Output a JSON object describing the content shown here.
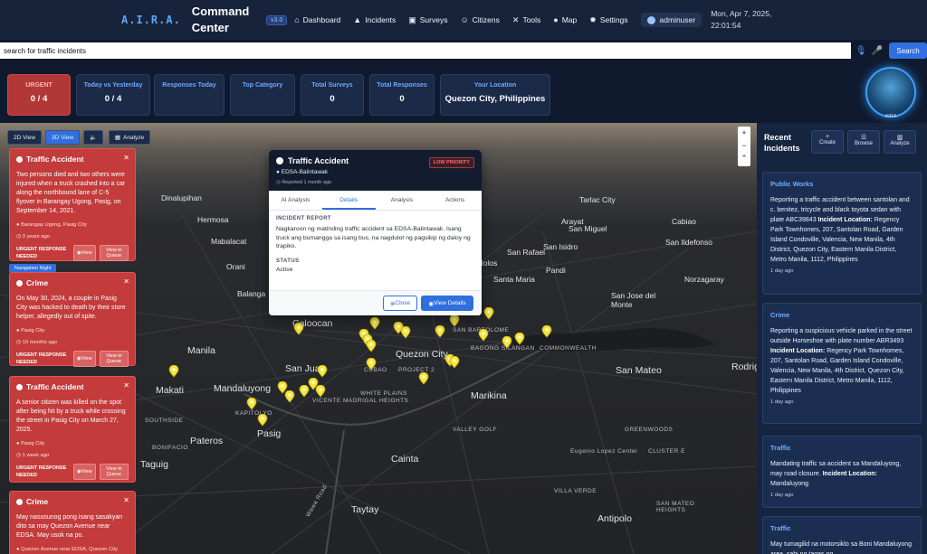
{
  "app": {
    "brand_aira": "A.I.R.A.",
    "brand_line1": "Command",
    "brand_line2": "Center",
    "version": "v3.0",
    "datetime_line1": "Mon, Apr 7, 2025,",
    "datetime_line2": "22:01:54",
    "user": "adminuser"
  },
  "nav": [
    {
      "label": "Dashboard",
      "icon": "home-icon"
    },
    {
      "label": "Incidents",
      "icon": "warning-icon"
    },
    {
      "label": "Surveys",
      "icon": "clipboard-icon"
    },
    {
      "label": "Citizens",
      "icon": "users-icon"
    },
    {
      "label": "Tools",
      "icon": "tools-icon"
    },
    {
      "label": "Map",
      "icon": "map-pin-icon"
    },
    {
      "label": "Settings",
      "icon": "gear-icon"
    }
  ],
  "search": {
    "value": "search for traffic incidents",
    "button": "Search"
  },
  "stats": [
    {
      "label": "URGENT",
      "value": "0 / 4"
    },
    {
      "label": "Today vs Yesterday",
      "value": "0 / 4"
    },
    {
      "label": "Responses Today",
      "value": ""
    },
    {
      "label": "Top Category",
      "value": ""
    },
    {
      "label": "Total Surveys",
      "value": "0"
    },
    {
      "label": "Total Responses",
      "value": "0"
    },
    {
      "label": "Your Location",
      "value": "Quezon City, Philippines"
    }
  ],
  "avatar_label": "AIRA",
  "map_controls": {
    "view2d": "2D View",
    "view3d": "3D View",
    "analyze": "Analyze",
    "zoom_in": "+",
    "zoom_out": "−"
  },
  "map_places": {
    "big": [
      "Manila",
      "Quezon City",
      "Makati",
      "Mandaluyong",
      "Pasig",
      "Marikina",
      "Taguig",
      "Cainta",
      "Taytay",
      "Antipolo",
      "Caloocan",
      "San Juan",
      "San Mateo",
      "Pateros",
      "Rodrig"
    ],
    "med": [
      "Tarlac City",
      "San Rafael",
      "Cabiao",
      "San Isidro",
      "Malolos",
      "Santa Maria",
      "San Jose del Monte",
      "Norzagaray",
      "Pandi",
      "Arayat",
      "Dinalupihan",
      "San Ildefonso",
      "San Miguel",
      "Mabalacat",
      "Hermosa",
      "Orani",
      "Balanga"
    ],
    "sm": [
      "PROJECT 2",
      "WHITE PLAINS",
      "CUBAO",
      "COMMONWEALTH",
      "SOUTHSIDE",
      "BAGONG SILANGAN",
      "SAN BARTOLOME",
      "VALLEY GOLF",
      "CLUSTER E",
      "GREENWOODS",
      "Eugenio Lopez Center",
      "VILLA VERDE",
      "BONIFACIO",
      "KAPITOLYO",
      "VICENTE MADRIGAL HEIGHTS",
      "SAN MATEO HEIGHTS",
      "Wawa Road"
    ]
  },
  "incident_cards": [
    {
      "title": "Traffic Accident",
      "desc": "Two persons died and two others were injured when a truck crashed into a car along the northbound lane of C-5 flyover in Barangay Ugong, Pasig, on September 14, 2021.",
      "location": "Barangay Ugong, Pasig City",
      "ago": "3 years ago",
      "urgent": "URGENT RESPONSE NEEDED",
      "view": "View",
      "queue": "View in Queue"
    },
    {
      "title": "Crime",
      "desc": "On May 30, 2024, a couple in Pasig City was hacked to death by their store helper, allegedly out of spite.",
      "location": "Pasig City",
      "ago": "10 months ago",
      "urgent": "URGENT RESPONSE NEEDED",
      "view": "View",
      "queue": "View in Queue"
    },
    {
      "title": "Traffic Accident",
      "desc": "A senior citizen was killed on the spot after being hit by a truck while crossing the street in Pasig City on March 27, 2025.",
      "location": "Pasig City",
      "ago": "1 week ago",
      "urgent": "URGENT RESPONSE NEEDED",
      "view": "View",
      "queue": "View in Queue"
    },
    {
      "title": "Crime",
      "desc": "May nasusunog pong isang sasakyan dito sa may Quezon Avenue near EDSA. May usok na po.",
      "location": "Quezon Avenue near EDSA, Quezon City",
      "ago": "",
      "urgent": "",
      "view": "",
      "queue": ""
    }
  ],
  "nav_night": "Navigation Night",
  "popup": {
    "title": "Traffic Accident",
    "location": "EDSA-Balintawak",
    "reported": "Reported 1 month ago",
    "priority": "LOW PRIORITY",
    "tabs": [
      "AI Analysis",
      "Details",
      "Analysis",
      "Actions"
    ],
    "report_heading": "INCIDENT REPORT",
    "report_text": "Nagkaroon ng matinding traffic accident sa EDSA-Balintawak. Isang truck ang bumangga sa isang bus, na nagdulot ng pagsikip ng daloy ng trapiko.",
    "status_heading": "STATUS",
    "status_value": "Active",
    "close": "Close",
    "view_details": "View Details"
  },
  "right_panel": {
    "title": "Recent Incidents",
    "buttons": [
      "Create",
      "Browse",
      "Analyze"
    ],
    "items": [
      {
        "category": "Public Works",
        "desc": "Reporting a traffic accident between santolan and c. benitez, tricycle and black toyota sedan with plate ABC39843",
        "loc_label": "Incident Location:",
        "loc": "Regency Park Townhomes, 207, Santolan Road, Garden Island Condoville, Valencia, New Manila, 4th District, Quezon City, Eastern Manila District, Metro Manila, 1112, Philippines",
        "ago": "1 day ago"
      },
      {
        "category": "Crime",
        "desc": "Reporting a suspicious vehicle parked in the street outside Horseshoe with plate number ABR3493",
        "loc_label": "Incident Location:",
        "loc": "Regency Park Townhomes, 207, Santolan Road, Garden Island Condoville, Valencia, New Manila, 4th District, Quezon City, Eastern Manila District, Metro Manila, 1112, Philippines",
        "ago": "1 day ago"
      },
      {
        "category": "Traffic",
        "desc": "Mandating traffic sa accident sa Mandaluyong, may road closure.",
        "loc_label": "Incident Location:",
        "loc": "Mandaluyong",
        "ago": "1 day ago"
      },
      {
        "category": "Traffic",
        "desc": "May tumagilid na motorsiklo sa Boni Mandaluyong area, sabi ng tagas ng",
        "loc_label": "",
        "loc": "",
        "ago": ""
      }
    ]
  }
}
